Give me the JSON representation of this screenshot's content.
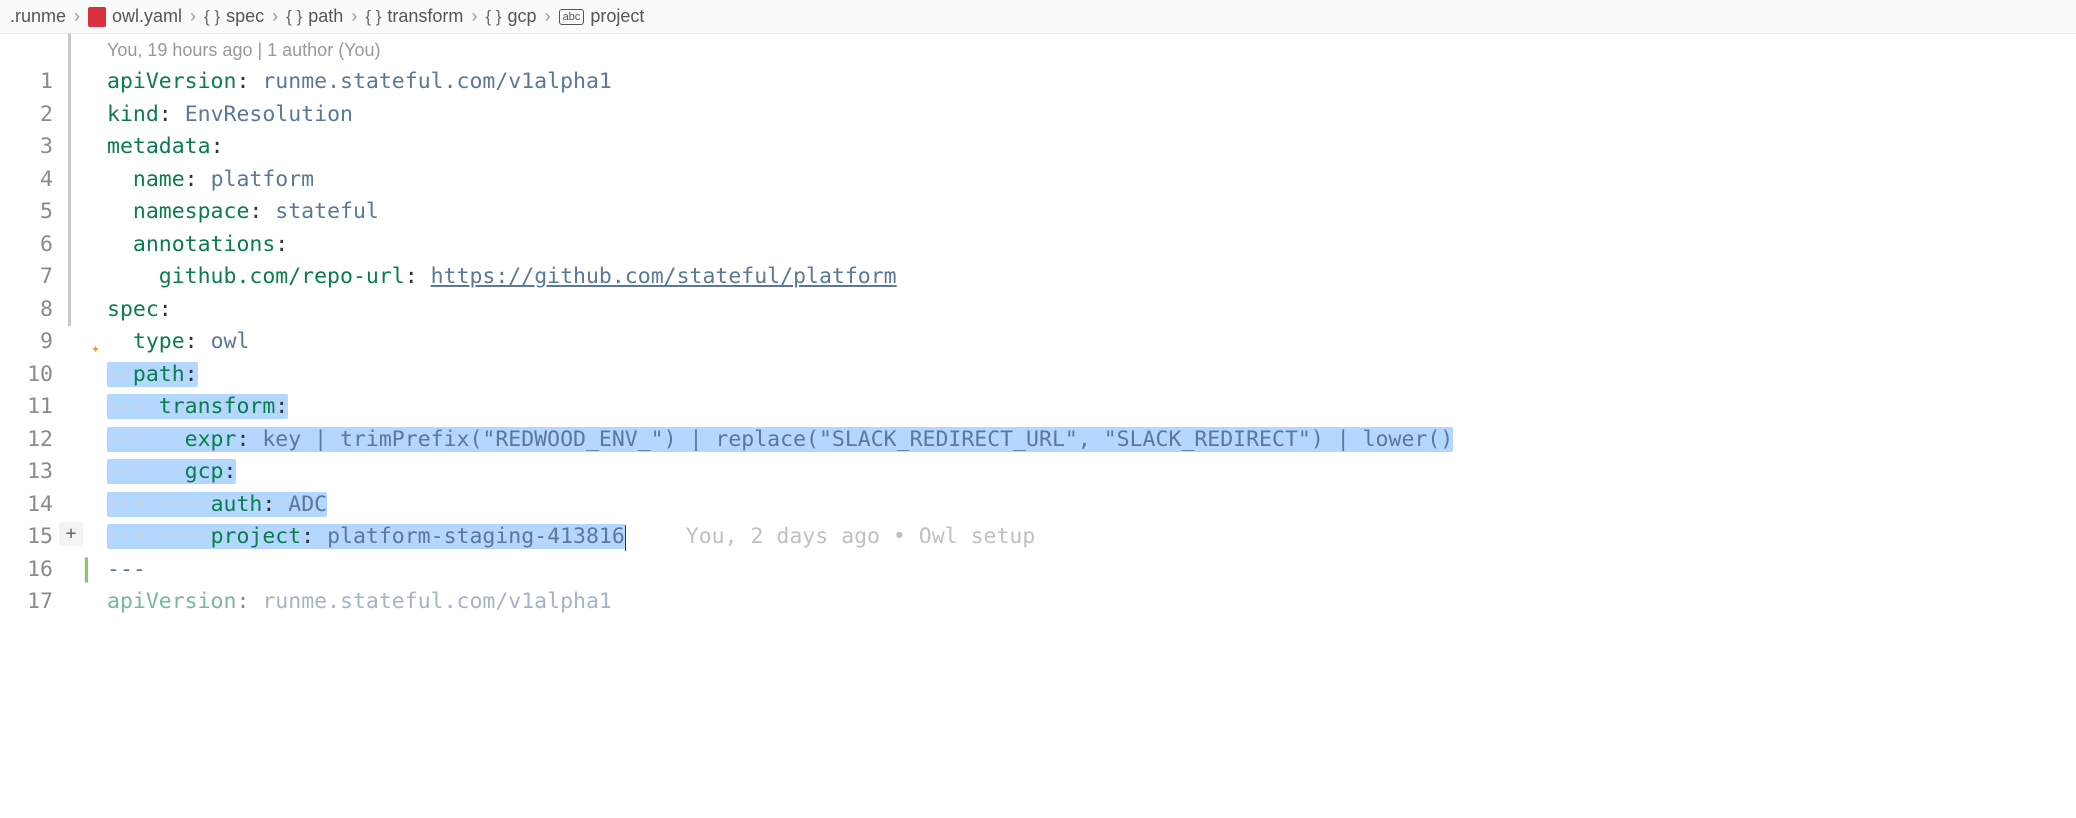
{
  "breadcrumb": {
    "items": [
      {
        "label": ".runme",
        "icon": null
      },
      {
        "label": "owl.yaml",
        "icon": "file"
      },
      {
        "label": "spec",
        "icon": "brace"
      },
      {
        "label": "path",
        "icon": "brace"
      },
      {
        "label": "transform",
        "icon": "brace"
      },
      {
        "label": "gcp",
        "icon": "brace"
      },
      {
        "label": "project",
        "icon": "abc"
      }
    ]
  },
  "blame_header": "You, 19 hours ago | 1 author (You)",
  "inline_blame": "You, 2 days ago • Owl setup",
  "line_numbers": [
    "1",
    "2",
    "3",
    "4",
    "5",
    "6",
    "7",
    "8",
    "9",
    "10",
    "11",
    "12",
    "13",
    "14",
    "15",
    "16",
    "17"
  ],
  "code": {
    "l1": {
      "key": "apiVersion",
      "val": "runme.stateful.com/v1alpha1"
    },
    "l2": {
      "key": "kind",
      "val": "EnvResolution"
    },
    "l3": {
      "key": "metadata"
    },
    "l4": {
      "key": "name",
      "val": "platform"
    },
    "l5": {
      "key": "namespace",
      "val": "stateful"
    },
    "l6": {
      "key": "annotations"
    },
    "l7": {
      "key": "github.com/repo-url",
      "val": "https://github.com/stateful/platform"
    },
    "l8": {
      "key": "spec"
    },
    "l9": {
      "key": "type",
      "val": "owl"
    },
    "l10": {
      "key": "path"
    },
    "l11": {
      "key": "transform"
    },
    "l12": {
      "key": "expr",
      "val": "key | trimPrefix(\"REDWOOD_ENV_\") | replace(\"SLACK_REDIRECT_URL\", \"SLACK_REDIRECT\") | lower()"
    },
    "l13": {
      "key": "gcp"
    },
    "l14": {
      "key": "auth",
      "val": "ADC"
    },
    "l15": {
      "key": "project",
      "val": "platform-staging-413816"
    },
    "l16": {
      "val": "---"
    },
    "l17": {
      "key": "apiVersion",
      "val": "runme.stateful.com/v1alpha1"
    }
  }
}
